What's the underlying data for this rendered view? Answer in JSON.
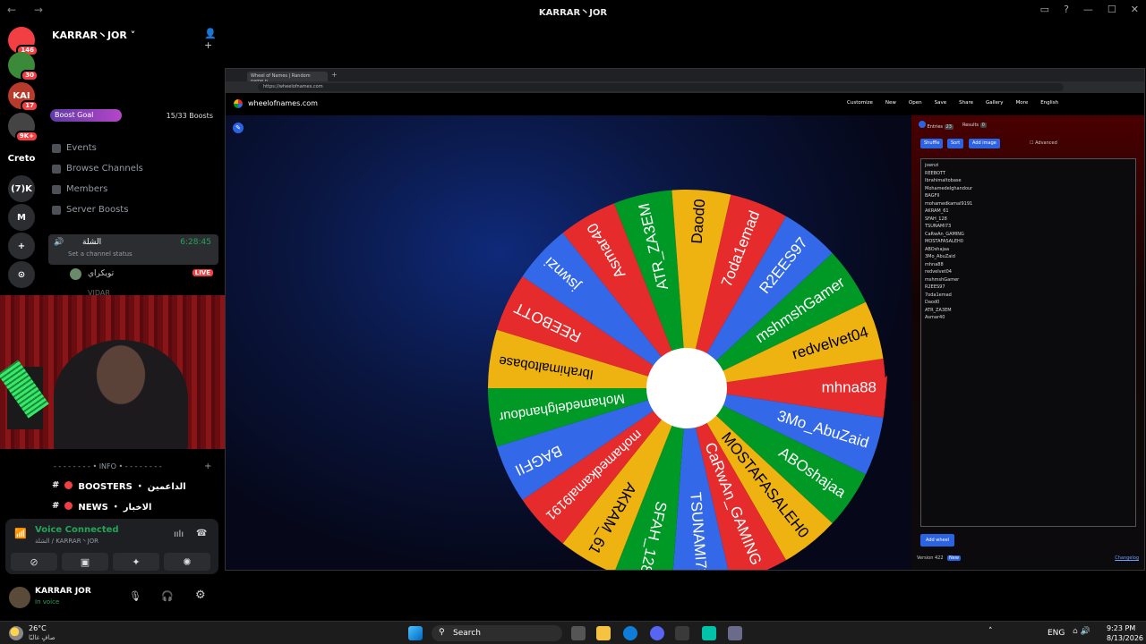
{
  "window": {
    "title": "KARRAR丶JOR",
    "nav_symbols": "← →"
  },
  "rail": {
    "servers": [
      {
        "label": "",
        "badge": "146",
        "color": "#f23f43"
      },
      {
        "label": "",
        "badge": "30",
        "color": "#3a8a3a"
      },
      {
        "label": "KAI",
        "badge": "17",
        "color": "#b83a2a"
      },
      {
        "label": "",
        "badge": "9K+",
        "color": "#444"
      },
      {
        "label": "Creto",
        "badge": "",
        "color": "#000"
      },
      {
        "label": "(7)K",
        "badge": "",
        "color": "#2b2d31"
      },
      {
        "label": "M",
        "badge": "",
        "color": "#2b2d31"
      },
      {
        "label": "+",
        "badge": "",
        "color": "#2b2d31"
      },
      {
        "label": "⊙",
        "badge": "",
        "color": "#2b2d31"
      }
    ]
  },
  "channels": {
    "server_name": "KARRAR丶JOR",
    "boost_label": "Boost Goal",
    "boost_count": "15/33 Boosts",
    "boost_progress": 0.45,
    "nav": [
      {
        "label": "Events"
      },
      {
        "label": "Browse Channels"
      },
      {
        "label": "Members"
      },
      {
        "label": "Server Boosts"
      }
    ],
    "voice_channel": {
      "name": "الشلة",
      "timer": "6:28:45",
      "status": "Set a channel status",
      "member": "تويكراي",
      "member_badge": "LIVE",
      "member2": "VIDAR"
    },
    "category": "- - - - - - - - • INFO • - - - - - - - -",
    "rows": [
      {
        "label": "BOOSTERS ・ الداعمين"
      },
      {
        "label": "NEWS ・ الاخبار"
      }
    ]
  },
  "voice": {
    "status": "Voice Connected",
    "path": "الشلة / KARRAR丶JOR"
  },
  "user": {
    "name": "KARRAR JOR",
    "status": "In voice"
  },
  "share": {
    "tab_title": "Wheel of Names | Random name p...",
    "url": "https://wheelofnames.com",
    "site": "wheelofnames.com",
    "menu": [
      "Customize",
      "New",
      "Open",
      "Save",
      "Share",
      "Gallery",
      "More",
      "English"
    ],
    "tabs": {
      "entries": "Entries",
      "entries_count": "23",
      "results": "Results",
      "results_count": "0"
    },
    "buttons": {
      "shuffle": "Shuffle",
      "sort": "Sort",
      "add_image": "Add image",
      "advanced": "Advanced",
      "add_wheel": "Add wheel"
    },
    "entries": [
      "jswnzi",
      "REEBOTT",
      "Ibrahimaltobase",
      "Mohamedelghandour",
      "BAGFII",
      "mohamedkamal9191",
      "AKRAM_61",
      "SFAH_128",
      "TSUNAMI73",
      "CaRwAn_GAMING",
      "MOSTAFASALEH0",
      "ABOshajaa",
      "3Mo_AbuZaid",
      "mhna88",
      "redvelvet04",
      "mshmshGamer",
      "R2EES97",
      "7oda1emad",
      "Daod0",
      "ATR_ZA3EM",
      "Asmar40"
    ],
    "version": "Version 422",
    "version_badge": "New",
    "changelog": "Changelog"
  },
  "wheel": {
    "slices": [
      {
        "label": "mhna88",
        "color": "#e52b2b"
      },
      {
        "label": "3Mo_AbuZaid",
        "color": "#3369e8"
      },
      {
        "label": "ABOshajaa",
        "color": "#009925"
      },
      {
        "label": "MOSTAFASALEH0",
        "color": "#eeb211"
      },
      {
        "label": "CaRwAn_GAMING",
        "color": "#e52b2b"
      },
      {
        "label": "TSUNAMI73",
        "color": "#3369e8"
      },
      {
        "label": "SFAH_128",
        "color": "#009925"
      },
      {
        "label": "AKRAM_61",
        "color": "#eeb211"
      },
      {
        "label": "mohamedkamal9191",
        "color": "#e52b2b"
      },
      {
        "label": "BAGFII",
        "color": "#3369e8"
      },
      {
        "label": "Mohamedelghandour",
        "color": "#009925"
      },
      {
        "label": "Ibrahimaltobase",
        "color": "#eeb211"
      },
      {
        "label": "REEBOTT",
        "color": "#e52b2b"
      },
      {
        "label": "jswnzi",
        "color": "#3369e8"
      },
      {
        "label": "Asmar40",
        "color": "#e52b2b"
      },
      {
        "label": "ATR_ZA3EM",
        "color": "#009925"
      },
      {
        "label": "Daod0",
        "color": "#eeb211"
      },
      {
        "label": "7oda1emad",
        "color": "#e52b2b"
      },
      {
        "label": "R2EES97",
        "color": "#3369e8"
      },
      {
        "label": "mshmshGamer",
        "color": "#009925"
      },
      {
        "label": "redvelvet04",
        "color": "#eeb211"
      }
    ]
  },
  "taskbar": {
    "weather_temp": "26°C",
    "weather_desc": "صافٍ غالبًا",
    "search": "Search",
    "lang": "ENG",
    "time": "9:23 PM",
    "date": "8/13/2026"
  }
}
